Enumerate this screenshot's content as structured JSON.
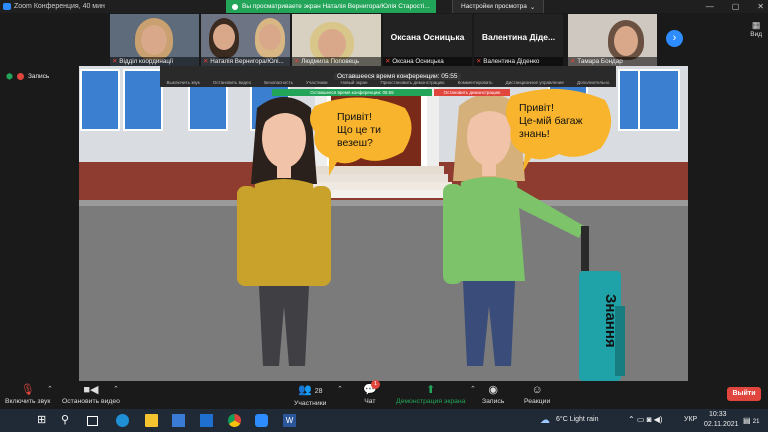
{
  "window": {
    "title": "Zoom Конференция, 40 мин",
    "share_banner": "Вы просматриваете экран Наталія Вернигора/Юлія Старості...",
    "view_options": "Настройки просмотра",
    "view_label": "Вид",
    "minimize": "—",
    "maximize": "▢",
    "close": "✕"
  },
  "participants": [
    {
      "name": "Відділ координації",
      "video": true
    },
    {
      "name": "Наталія Вернигора/Юлі...",
      "video": true
    },
    {
      "name": "Людмила Поповець",
      "video": true
    },
    {
      "name": "Оксана Осницька",
      "video": false
    },
    {
      "name": "Валентина Діденко",
      "video": false
    },
    {
      "name": "Тамара Бондар",
      "video": true
    }
  ],
  "participants_big_names": [
    "Оксана Осницька",
    "Валентина Діде..."
  ],
  "record_label": "Запись",
  "shared_screen": {
    "remaining_time": "Оставшееся время конференции: 05:55",
    "green_bar": "Оставшееся время конференции: 05:55",
    "red_bar": "Остановить демонстрацию",
    "mini_toolbar": [
      "Выключить звук",
      "Остановить видео",
      "Безопасность",
      "Участники",
      "Новый экран",
      "Приостановить демонстрацию",
      "Комментировать",
      "Дистанционное управление",
      "Дополнительно"
    ],
    "bubble_left": [
      "Привіт!",
      "Що це ти",
      "везеш?"
    ],
    "bubble_right": [
      "Привіт!",
      "Це-мій багаж",
      "знань!"
    ],
    "suitcase_text": "Знання"
  },
  "toolbar": {
    "mute_label": "Включить звук",
    "video_label": "Остановить видео",
    "participants_label": "Участники",
    "participants_count": "28",
    "chat_label": "Чат",
    "chat_badge": "1",
    "share_label": "Демонстрация экрана",
    "record_label": "Запись",
    "reactions_label": "Реакции",
    "leave_label": "Выйти"
  },
  "taskbar": {
    "weather": "6°C  Light rain",
    "lang": "УКР",
    "time": "10:33",
    "date": "02.11.2021",
    "notif_count": "21"
  },
  "colors": {
    "accent": "#2d8cff",
    "share_green": "#23a559",
    "leave_red": "#e0463d",
    "bubble": "#f7b42c"
  }
}
